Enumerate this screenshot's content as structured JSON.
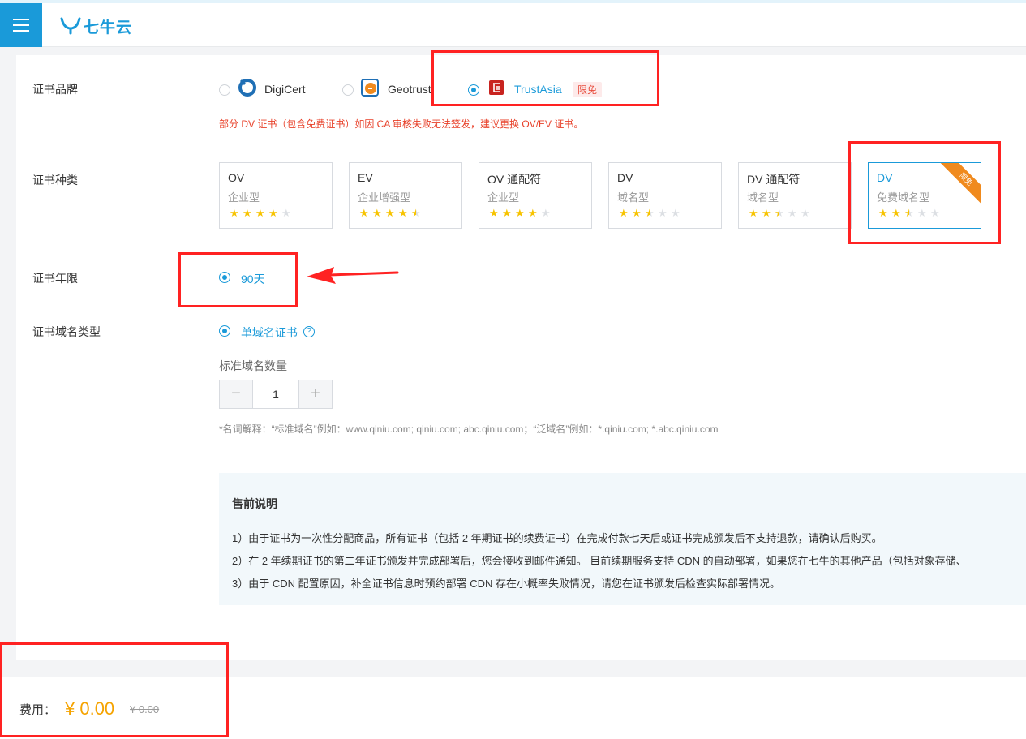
{
  "header": {
    "logo_text": "七牛云"
  },
  "form": {
    "brand": {
      "label": "证书品牌",
      "options": [
        {
          "name": "DigiCert",
          "selected": false
        },
        {
          "name": "Geotrust",
          "selected": false
        },
        {
          "name": "TrustAsia",
          "selected": true,
          "tag": "限免"
        }
      ],
      "warning": "部分 DV 证书（包含免费证书）如因 CA 审核失败无法签发，建议更换 OV/EV 证书。"
    },
    "type": {
      "label": "证书种类",
      "cards": [
        {
          "title": "OV",
          "subtitle": "企业型",
          "rating": 4,
          "selected": false
        },
        {
          "title": "EV",
          "subtitle": "企业增强型",
          "rating": 4.5,
          "selected": false
        },
        {
          "title": "OV 通配符",
          "subtitle": "企业型",
          "rating": 4,
          "selected": false
        },
        {
          "title": "DV",
          "subtitle": "域名型",
          "rating": 2.5,
          "selected": false
        },
        {
          "title": "DV 通配符",
          "subtitle": "域名型",
          "rating": 2.5,
          "selected": false
        },
        {
          "title": "DV",
          "subtitle": "免费域名型",
          "rating": 2.5,
          "selected": true,
          "ribbon": "限免"
        }
      ]
    },
    "duration": {
      "label": "证书年限",
      "option": "90天"
    },
    "domain_type": {
      "label": "证书域名类型",
      "option": "单域名证书",
      "help_icon": "?",
      "count_label": "标准域名数量",
      "count_value": "1",
      "minus": "−",
      "plus": "+",
      "note": "*名词解释：“标准域名”例如：www.qiniu.com; qiniu.com; abc.qiniu.com；“泛域名”例如：*.qiniu.com; *.abc.qiniu.com"
    }
  },
  "presale": {
    "title": "售前说明",
    "lines": [
      "1）由于证书为一次性分配商品，所有证书（包括 2 年期证书的续费证书）在完成付款七天后或证书完成颁发后不支持退款，请确认后购买。",
      "2）在 2 年续期证书的第二年证书颁发并完成部署后，您会接收到邮件通知。 目前续期服务支持 CDN 的自动部署，如果您在七牛的其他产品（包括对象存储、",
      "3）由于 CDN 配置原因，补全证书信息时预约部署 CDN 存在小概率失败情况，请您在证书颁发后检查实际部署情况。"
    ]
  },
  "footer": {
    "fee_label": "费用：",
    "price": "¥ 0.00",
    "original_price": "¥ 0.00"
  },
  "colors": {
    "accent": "#1a9ad9",
    "warning": "#e8412a",
    "price": "#f5a300",
    "annotation": "#ff2222",
    "star": "#f7c300"
  }
}
